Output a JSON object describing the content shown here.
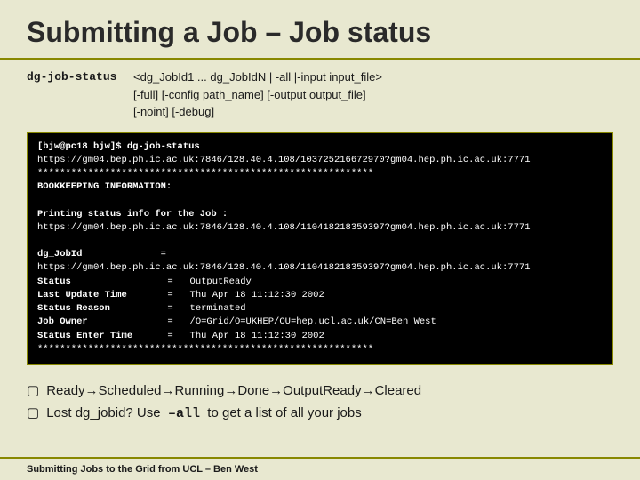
{
  "title": "Submitting a Job – Job status",
  "command": {
    "label": "dg-job-status",
    "syntax_line1": "<dg_JobId1 ... dg_JobIdN | -all |-input input_file>",
    "syntax_line2": "[-full] [-config path_name] [-output output_file]",
    "syntax_line3": "[-noint] [-debug]"
  },
  "terminal": {
    "line1": "[bjw@pc18 bjw]$ dg-job-status",
    "line2": "https://gm04.bep.ph.ic.ac.uk:7846/128.40.4.108/103725216672970?gm04.hep.ph.ic.ac.uk:7771",
    "separator1": "************************************************************",
    "bookkeeping": "BOOKKEEPING INFORMATION:",
    "printing": "Printing status info for the Job :",
    "job_url": "https://gm04.bep.ph.ic.ac.uk:7846/128.40.4.108/110418218359397?gm04.hep.ph.ic.ac.uk:7771",
    "blank": "",
    "dg_job_id_label": "dg_JobId",
    "dg_job_id_eq": "=",
    "dg_job_id_val": "https://gm04.bep.ph.ic.ac.uk:7846/128.40.4.108/110418218359397?gm04.hep.ph.ic.ac.uk:7771",
    "status_label": "Status",
    "status_eq": "=",
    "status_val": "OutputReady",
    "last_update_label": "Last Update Time",
    "last_update_eq": "=",
    "last_update_val": "Thu Apr 18 11:12:30 2002",
    "status_reason_label": "Status Reason",
    "status_reason_eq": "=",
    "status_reason_val": "terminated",
    "job_owner_label": "Job Owner",
    "job_owner_eq": "=",
    "job_owner_val": "/O=Grid/O=UKHEP/OU=hep.ucl.ac.uk/CN=Ben West",
    "status_enter_label": "Status Enter Time",
    "status_enter_eq": "=",
    "status_enter_val": "Thu Apr 18 11:12:30 2002",
    "separator2": "************************************************************"
  },
  "bullets": [
    {
      "text_parts": [
        "Ready",
        "→",
        "Scheduled",
        "→",
        "Running",
        "→",
        "Done",
        "→",
        "OutputReady",
        "→",
        "Cleared"
      ],
      "display": "Ready→Scheduled→Running→Done→OutputReady→Cleared"
    },
    {
      "display": "Lost dg_jobid? Use  –all to get a list of all your jobs"
    }
  ],
  "footer": "Submitting Jobs to the Grid from UCL – Ben West"
}
